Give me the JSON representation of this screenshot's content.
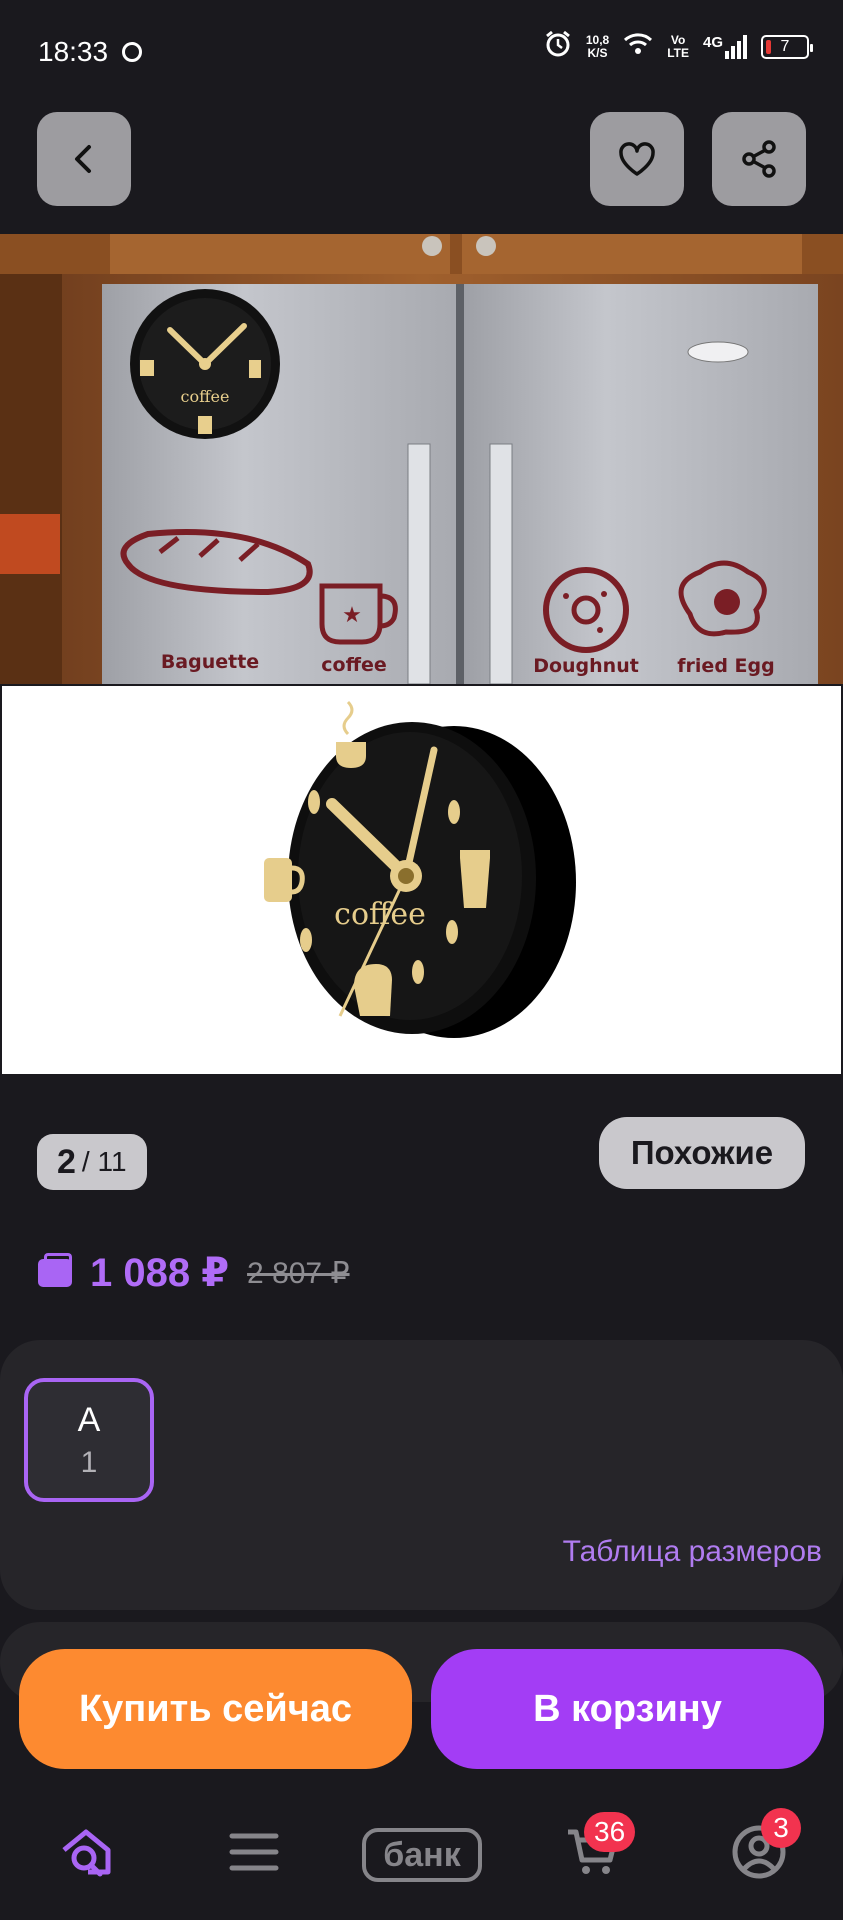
{
  "status_bar": {
    "time": "18:33",
    "speed_top": "10,8",
    "speed_bottom": "K/S",
    "volte_top": "Vo",
    "volte_bottom": "LTE",
    "network": "4G",
    "battery": "7"
  },
  "top_actions": {
    "back_icon": "chevron-left-icon",
    "favorite_icon": "heart-icon",
    "share_icon": "share-icon"
  },
  "gallery": {
    "photo1_labels": [
      "coffee",
      "Baguette",
      "coffee",
      "Doughnut",
      "fried Egg"
    ],
    "photo2_label": "coffee",
    "current": "2",
    "total": "/ 11"
  },
  "similar_label": "Похожие",
  "price": {
    "current": "1 088 ₽",
    "old": "2 807 ₽",
    "accent_color": "#a965f4"
  },
  "variant": {
    "label": "A",
    "count": "1"
  },
  "size_table_link": "Таблица размеров",
  "buttons": {
    "buy_now": "Купить сейчас",
    "add_to_cart": "В корзину",
    "buy_color": "#fd8a30",
    "cart_color": "#a33df5"
  },
  "bottom_nav": {
    "bank_label": "банк",
    "cart_badge": "36",
    "profile_badge": "3",
    "icons": [
      "home-search-icon",
      "menu-icon",
      "bank-icon",
      "cart-icon",
      "profile-icon"
    ]
  }
}
